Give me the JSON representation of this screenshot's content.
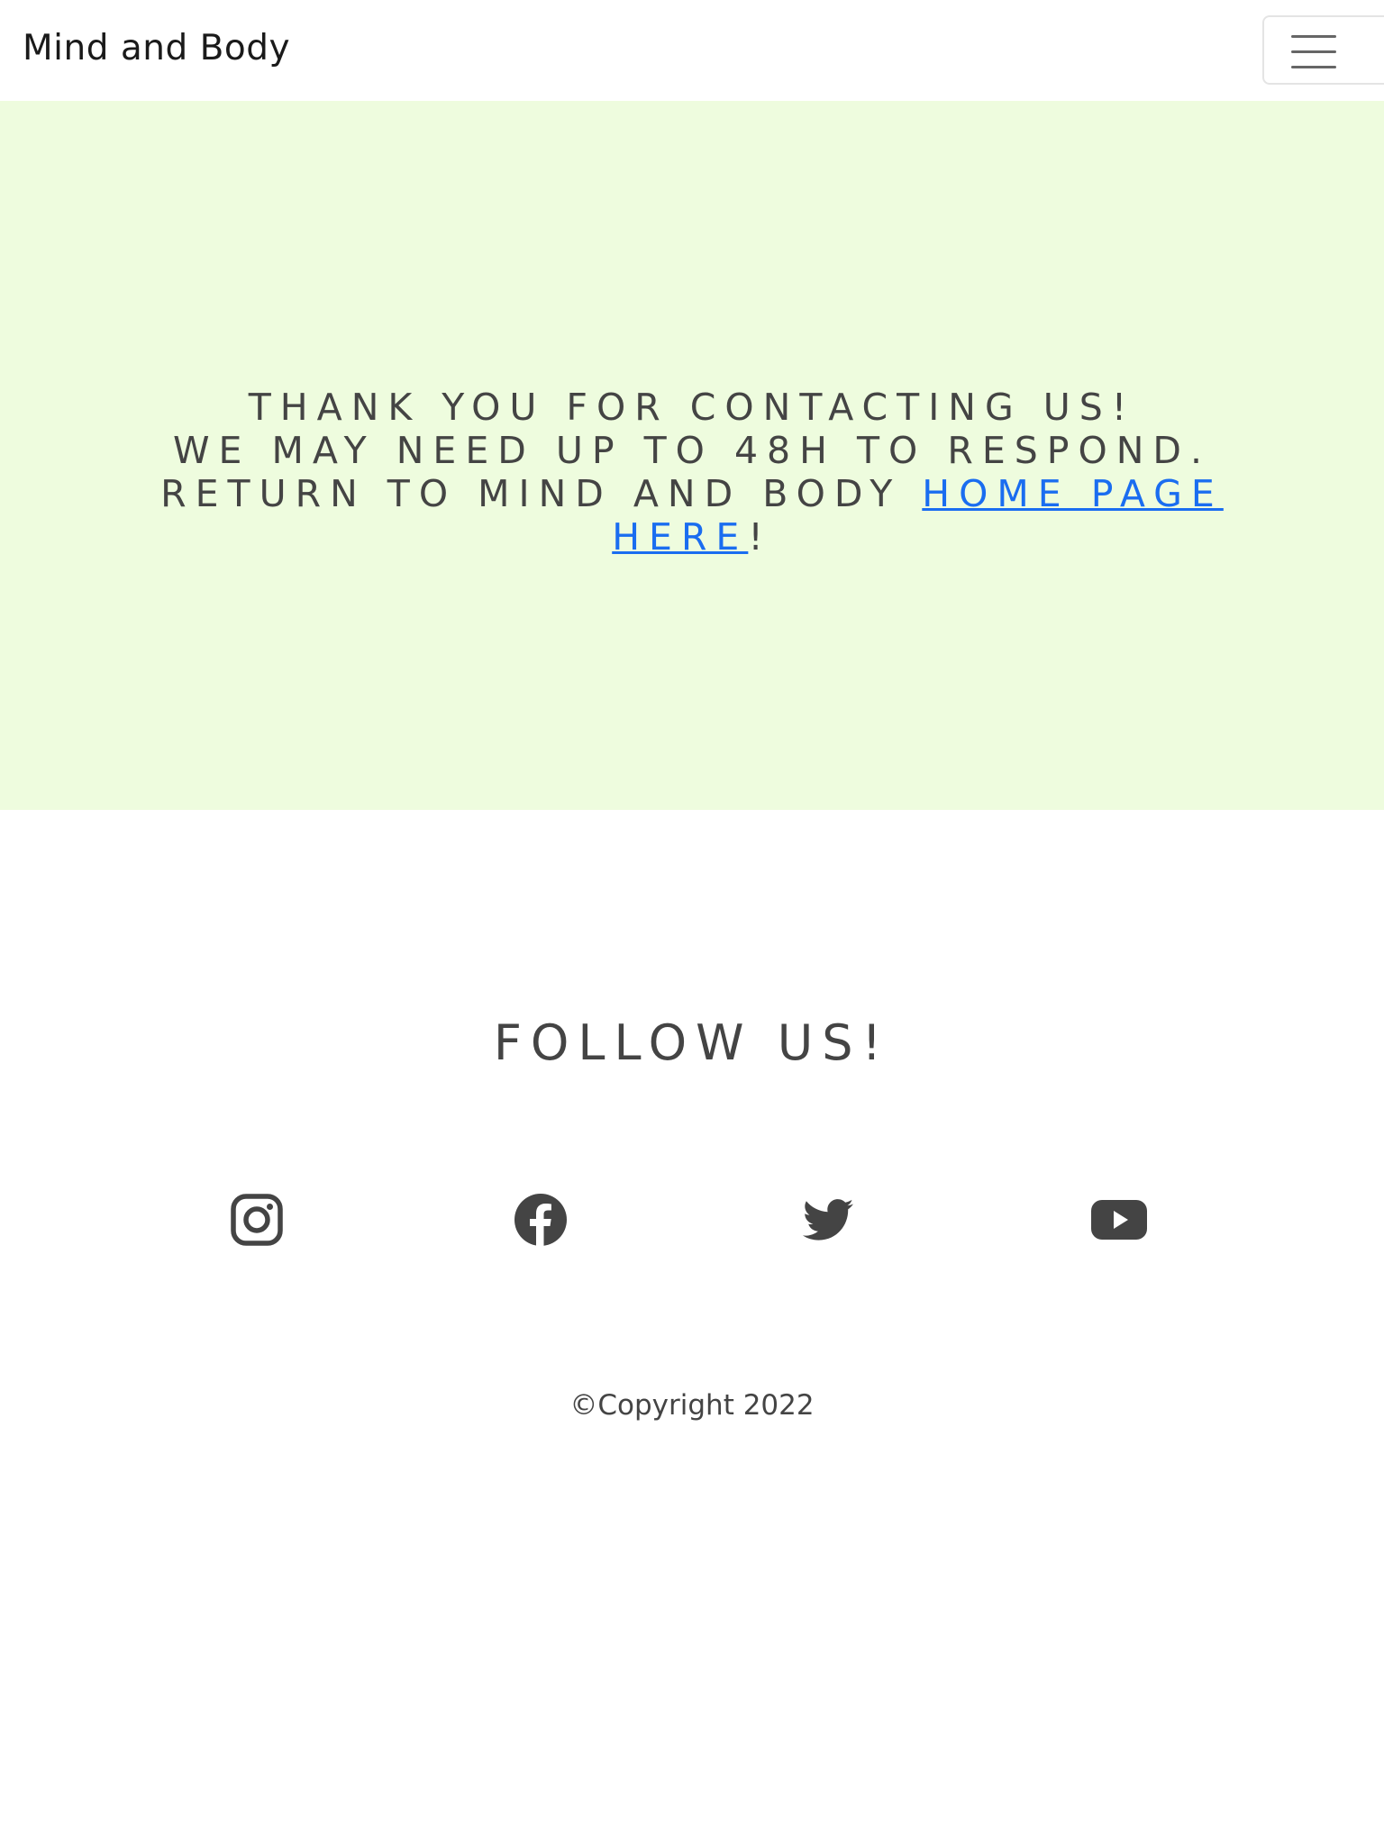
{
  "navbar": {
    "brand": "Mind and Body",
    "toggler_icon": "hamburger-menu-icon"
  },
  "hero": {
    "line1": "Thank you for contacting us!",
    "line2": "We may need up to 48h to respond.",
    "line3_prefix": "Return to Mind and Body ",
    "link_text": "Home page here",
    "line3_suffix": "!",
    "link_color": "#1a6df0",
    "background": "#eefcde"
  },
  "footer": {
    "heading": "Follow us!",
    "social_icons": [
      "instagram-icon",
      "facebook-icon",
      "twitter-icon",
      "youtube-icon"
    ],
    "copyright": "©Copyright 2022"
  }
}
